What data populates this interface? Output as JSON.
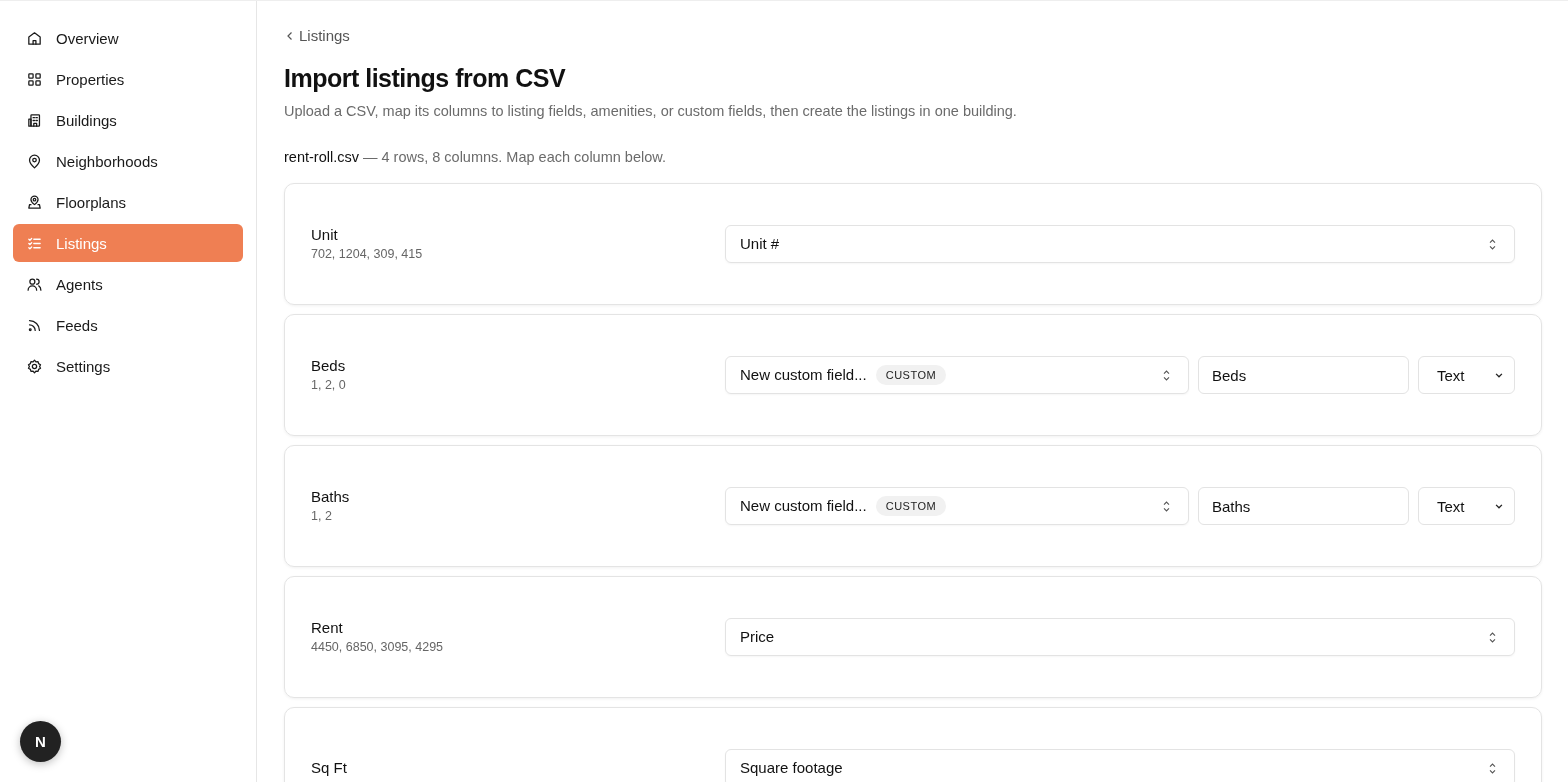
{
  "sidebar": {
    "items": [
      {
        "label": "Overview",
        "selected": false
      },
      {
        "label": "Properties",
        "selected": false
      },
      {
        "label": "Buildings",
        "selected": false
      },
      {
        "label": "Neighborhoods",
        "selected": false
      },
      {
        "label": "Floorplans",
        "selected": false
      },
      {
        "label": "Listings",
        "selected": true
      },
      {
        "label": "Agents",
        "selected": false
      },
      {
        "label": "Feeds",
        "selected": false
      },
      {
        "label": "Settings",
        "selected": false
      }
    ]
  },
  "dev_badge": "N",
  "breadcrumb": "Listings",
  "title": "Import listings from CSV",
  "description": "Upload a CSV, map its columns to listing fields, amenities, or custom fields, then create the listings in one building.",
  "file": {
    "name": "rent-roll.csv",
    "summary": "— 4 rows, 8 columns. Map each column below."
  },
  "columns": [
    {
      "kind": "mapped",
      "name": "Unit",
      "sample": "702, 1204, 309, 415",
      "target": "Unit #"
    },
    {
      "kind": "custom",
      "name": "Beds",
      "sample": "1, 2, 0",
      "target": "New custom field...",
      "badge": "CUSTOM",
      "field_name": "Beds",
      "field_type": "Text"
    },
    {
      "kind": "custom",
      "name": "Baths",
      "sample": "1, 2",
      "target": "New custom field...",
      "badge": "CUSTOM",
      "field_name": "Baths",
      "field_type": "Text"
    },
    {
      "kind": "mapped",
      "name": "Rent",
      "sample": "4450, 6850, 3095, 4295",
      "target": "Price"
    },
    {
      "kind": "mapped",
      "name": "Sq Ft",
      "target": "Square footage"
    }
  ]
}
